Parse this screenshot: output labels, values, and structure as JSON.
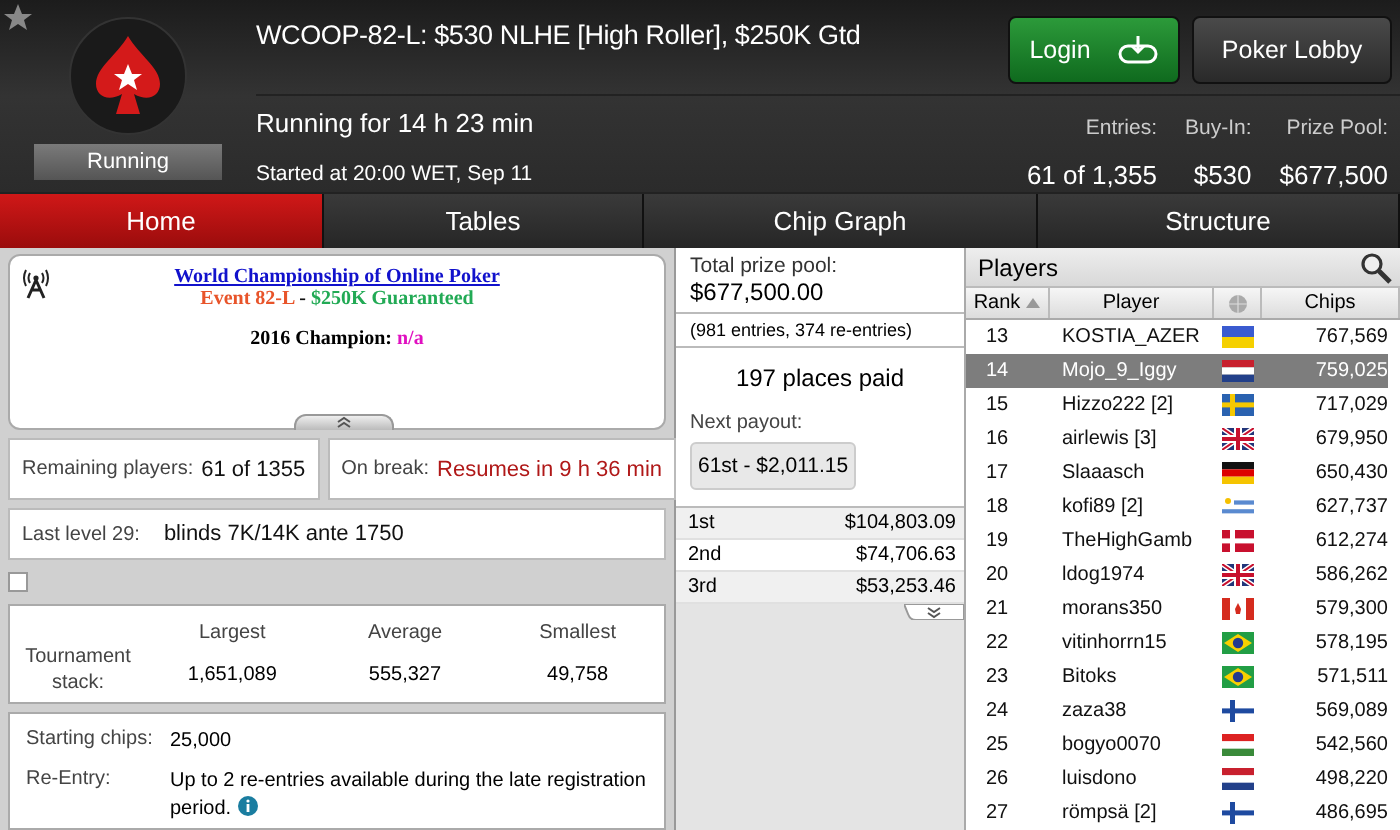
{
  "header": {
    "title": "WCOOP-82-L: $530 NLHE [High Roller], $250K Gtd",
    "status": "Running",
    "running_for": "Running for 14 h 23 min",
    "started": "Started at 20:00 WET, Sep 11",
    "buttons": [
      {
        "label": "Login",
        "kind": "login"
      },
      {
        "label": "Poker Lobby",
        "kind": "plain"
      }
    ],
    "stats": [
      {
        "label": "Entries:",
        "value": "61 of 1,355"
      },
      {
        "label": "Buy-In:",
        "value": "$530"
      },
      {
        "label": "Prize Pool:",
        "value": "$677,500"
      }
    ]
  },
  "tabs": [
    {
      "label": "Home",
      "selected": true
    },
    {
      "label": "Tables",
      "selected": false
    },
    {
      "label": "Chip Graph",
      "selected": false
    },
    {
      "label": "Structure",
      "selected": false
    }
  ],
  "info": {
    "link": "World Championship of Online Poker",
    "event_line": [
      {
        "text": "Event 82-L",
        "color": "#e8542a"
      },
      {
        "text": " - ",
        "color": "#111111"
      },
      {
        "text": "$250K Guaranteed",
        "color": "#22aa55"
      }
    ],
    "champion_label": "2016 Champion:",
    "champion_value": "n/a"
  },
  "remaining": {
    "label": "Remaining players:",
    "value": "61 of 1355"
  },
  "break": {
    "label": "On break:",
    "value": "Resumes in 9 h 36 min"
  },
  "last_level": {
    "label": "Last level 29:",
    "value": "blinds 7K/14K ante 1750"
  },
  "checkbox": {
    "checked": false
  },
  "stack": {
    "label": "Tournament stack:",
    "columns": [
      "Largest",
      "Average",
      "Smallest"
    ],
    "values": [
      "1,651,089",
      "555,327",
      "49,758"
    ]
  },
  "details": [
    {
      "label": "Starting chips:",
      "value": "25,000",
      "info": false
    },
    {
      "label": "Re-Entry:",
      "value": "Up to 2 re-entries available during the late registration period.",
      "info": true
    }
  ],
  "prize": {
    "total_label": "Total prize pool:",
    "total": "$677,500.00",
    "entries": "(981 entries, 374 re-entries)",
    "places": "197 places paid",
    "next_label": "Next payout:",
    "next": "61st - $2,011.15",
    "payouts": [
      {
        "place": "1st",
        "amount": "$104,803.09"
      },
      {
        "place": "2nd",
        "amount": "$74,706.63"
      },
      {
        "place": "3rd",
        "amount": "$53,253.46"
      }
    ]
  },
  "players": {
    "title": "Players",
    "columns": [
      "Rank",
      "Player",
      "Chips"
    ],
    "rows": [
      {
        "rank": "13",
        "name": "KOSTIA_AZER",
        "kind": "ukraine",
        "chips": "767,569",
        "selected": false
      },
      {
        "rank": "14",
        "name": "Mojo_9_Iggy",
        "kind": "netherlands",
        "chips": "759,025",
        "selected": true
      },
      {
        "rank": "15",
        "name": "Hizzo222 [2]",
        "kind": "sweden",
        "chips": "717,029",
        "selected": false
      },
      {
        "rank": "16",
        "name": "airlewis [3]",
        "kind": "uk",
        "chips": "679,950",
        "selected": false
      },
      {
        "rank": "17",
        "name": "Slaaasch",
        "kind": "germany",
        "chips": "650,430",
        "selected": false
      },
      {
        "rank": "18",
        "name": "kofi89 [2]",
        "kind": "uruguay",
        "chips": "627,737",
        "selected": false
      },
      {
        "rank": "19",
        "name": "TheHighGamb",
        "kind": "denmark",
        "chips": "612,274",
        "selected": false
      },
      {
        "rank": "20",
        "name": "ldog1974",
        "kind": "uk",
        "chips": "586,262",
        "selected": false
      },
      {
        "rank": "21",
        "name": "morans350",
        "kind": "canada",
        "chips": "579,300",
        "selected": false
      },
      {
        "rank": "22",
        "name": "vitinhorrn15",
        "kind": "brazil",
        "chips": "578,195",
        "selected": false
      },
      {
        "rank": "23",
        "name": "Bitoks",
        "kind": "brazil",
        "chips": "571,511",
        "selected": false
      },
      {
        "rank": "24",
        "name": "zaza38",
        "kind": "finland",
        "chips": "569,089",
        "selected": false
      },
      {
        "rank": "25",
        "name": "bogyo0070",
        "kind": "hungary",
        "chips": "542,560",
        "selected": false
      },
      {
        "rank": "26",
        "name": "luisdono",
        "kind": "netherlands",
        "chips": "498,220",
        "selected": false
      },
      {
        "rank": "27",
        "name": "römpsä [2]",
        "kind": "finland",
        "chips": "486,695",
        "selected": false
      }
    ]
  }
}
